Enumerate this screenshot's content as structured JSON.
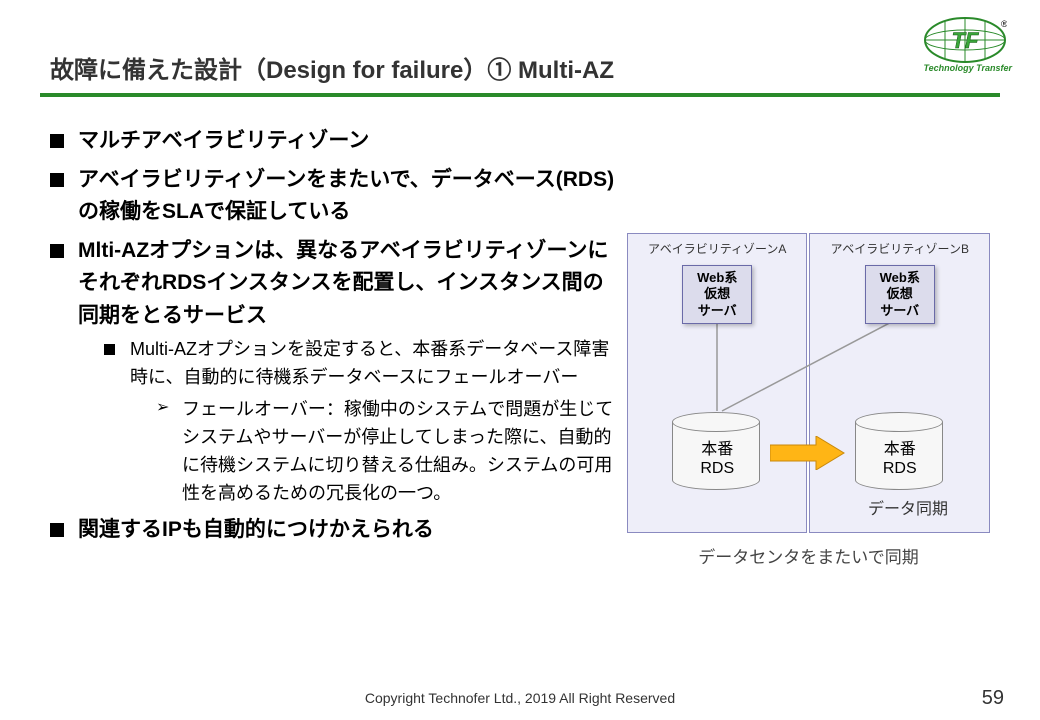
{
  "logo": {
    "initials": "TF",
    "tagline": "Technology Transfer"
  },
  "title": "故障に備えた設計（Design for failure）①  Multi-AZ",
  "bullets": {
    "b1": "マルチアベイラビリティゾーン",
    "b2": "アベイラビリティゾーンをまたいで、データベース(RDS)の稼働をSLAで保証している",
    "b3": "Mlti-AZオプションは、異なるアベイラビリティゾーンにそれぞれRDSインスタンスを配置し、インスタンス間の同期をとるサービス",
    "b3_1": "Multi-AZオプションを設定すると、本番系データベース障害時に、自動的に待機系データベースにフェールオーバー",
    "b3_1_1": "フェールオーバー：稼働中のシステムで問題が生じてシステムやサーバーが停止してしまった際に、自動的に待機システムに切り替える仕組み。システムの可用性を高めるための冗長化の一つ。",
    "b4": "関連するIPも自動的につけかえられる"
  },
  "diagram": {
    "zoneA_title": "アベイラビリティゾーンA",
    "zoneB_title": "アベイラビリティゾーンB",
    "vm_line1": "Web系",
    "vm_line2": "仮想",
    "vm_line3": "サーバ",
    "rds_line1": "本番",
    "rds_line2": "RDS",
    "sync_label": "データ同期",
    "caption": "データセンタをまたいで同期"
  },
  "footer": "Copyright Technofer  Ltd., 2019 All Right Reserved",
  "page": "59"
}
